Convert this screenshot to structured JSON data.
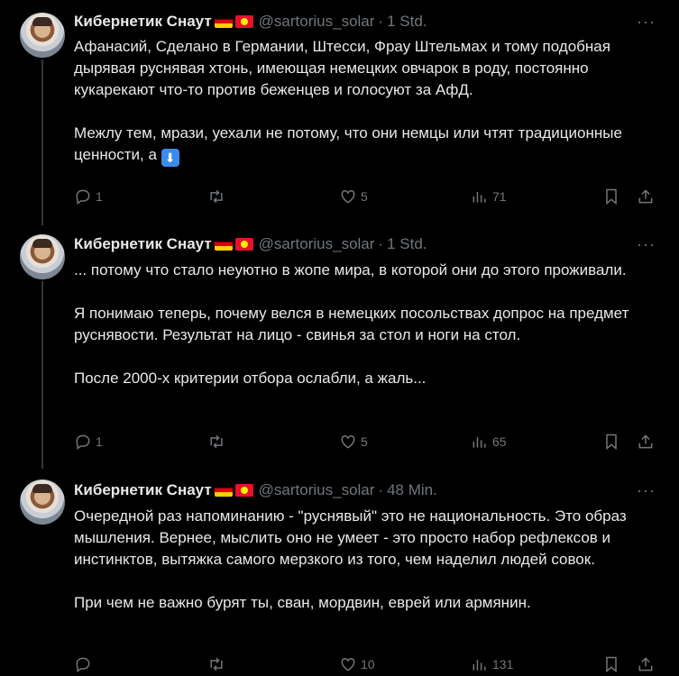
{
  "tweets": [
    {
      "name": "Кибернетик Снаут",
      "handle": "@sartorius_solar",
      "time": "1 Std.",
      "paragraphs": [
        "Афанасий, Сделано в Германии, Штесси, Фрау Штельмах и тому подобная дырявая руснявая хтонь, имеющая немецких овчарок в роду, постоянно кукарекают что-то против беженцев и голосуют за АфД.",
        "Межлу тем,  мрази, уехали не потому, что они немцы или чтят традиционные ценности, а"
      ],
      "replies": "1",
      "retweets": "",
      "likes": "5",
      "views": "71"
    },
    {
      "name": "Кибернетик Снаут",
      "handle": "@sartorius_solar",
      "time": "1 Std.",
      "paragraphs": [
        "... потому что стало неуютно в жопе мира, в которой они до этого проживали.",
        "Я понимаю теперь, почему велся в немецких  посольствах допрос на предмет руснявости. Результат на лицо - свинья за стол и ноги на стол.",
        "После 2000-х критерии отбора ослабли, а жаль..."
      ],
      "replies": "1",
      "retweets": "",
      "likes": "5",
      "views": "65"
    },
    {
      "name": "Кибернетик Снаут",
      "handle": "@sartorius_solar",
      "time": "48 Min.",
      "paragraphs": [
        "Очередной раз напоминанию - \"руснявый\" это не национальность. Это образ мышления. Вернее,  мыслить оно не умеет -  это просто набор рефлексов и инстинктов, вытяжка самого мерзкого из того, чем наделил людей совок.",
        "При чем не важно бурят ты, сван, мордвин, еврей или армянин."
      ],
      "replies": "",
      "retweets": "",
      "likes": "10",
      "views": "131"
    }
  ],
  "icons": {
    "reply": "reply-icon",
    "retweet": "retweet-icon",
    "like": "heart-icon",
    "views": "views-icon",
    "bookmark": "bookmark-icon",
    "share": "share-icon",
    "more": "more-icon",
    "down_arrow_emoji": "⬇"
  },
  "more_glyph": "···",
  "colors": {
    "background": "#000000",
    "text": "#e7e9ea",
    "muted": "#71767b",
    "line": "#333639"
  }
}
